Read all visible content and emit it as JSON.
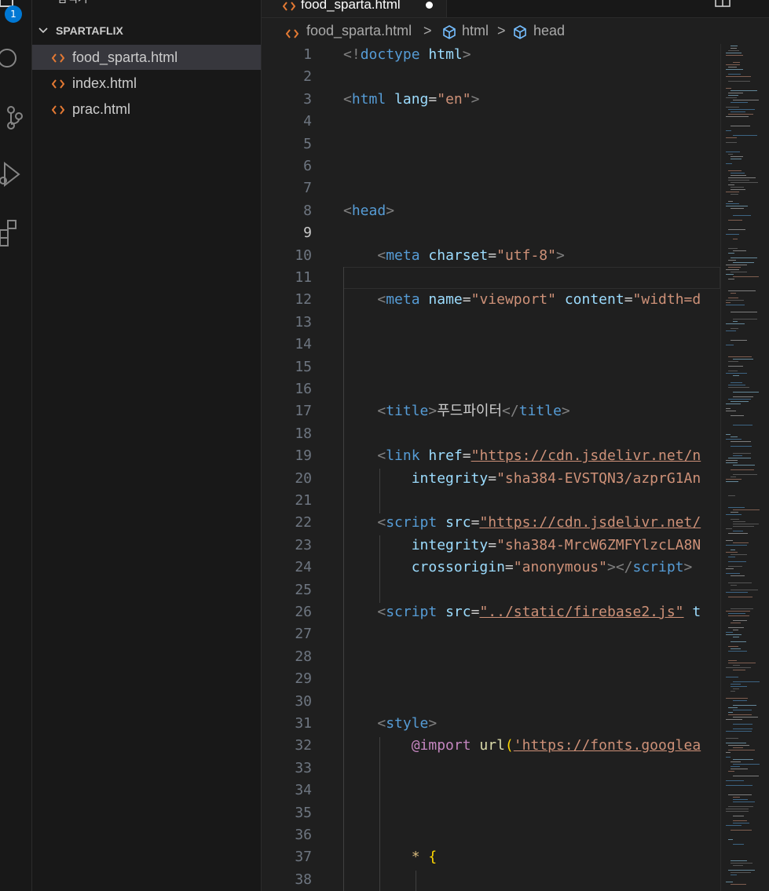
{
  "activity_bar": {
    "badge": "1"
  },
  "sidebar": {
    "title": "탐색기",
    "folder": "SPARTAFLIX",
    "files": [
      {
        "name": "food_sparta.html",
        "active": true
      },
      {
        "name": "index.html",
        "active": false
      },
      {
        "name": "prac.html",
        "active": false
      }
    ]
  },
  "editor": {
    "tab": {
      "name": "food_sparta.html"
    },
    "breadcrumb": {
      "file": "food_sparta.html",
      "sep": ">",
      "item1": "html",
      "item2": "head"
    },
    "current_line": 9,
    "lines": [
      {
        "n": "1",
        "t": [
          [
            "br",
            "<!"
          ],
          [
            "tag",
            "doctype"
          ],
          [
            "txtc",
            " "
          ],
          [
            "attr",
            "html"
          ],
          [
            "br",
            ">"
          ]
        ]
      },
      {
        "n": "2",
        "t": []
      },
      {
        "n": "3",
        "t": [
          [
            "br",
            "<"
          ],
          [
            "tag",
            "html"
          ],
          [
            "txtc",
            " "
          ],
          [
            "attr",
            "lang"
          ],
          [
            "txtc",
            "="
          ],
          [
            "str",
            "\"en\""
          ],
          [
            "br",
            ">"
          ]
        ]
      },
      {
        "n": "4",
        "t": []
      },
      {
        "n": "5",
        "t": []
      },
      {
        "n": "6",
        "t": []
      },
      {
        "n": "7",
        "t": []
      },
      {
        "n": "8",
        "t": [
          [
            "br",
            "<"
          ],
          [
            "tag",
            "head"
          ],
          [
            "br",
            ">"
          ]
        ]
      },
      {
        "n": "9",
        "t": []
      },
      {
        "n": "10",
        "t": [
          [
            "txtc",
            "    "
          ],
          [
            "br",
            "<"
          ],
          [
            "tag",
            "meta"
          ],
          [
            "txtc",
            " "
          ],
          [
            "attr",
            "charset"
          ],
          [
            "txtc",
            "="
          ],
          [
            "str",
            "\"utf-8\""
          ],
          [
            "br",
            ">"
          ]
        ]
      },
      {
        "n": "11",
        "t": []
      },
      {
        "n": "12",
        "t": [
          [
            "txtc",
            "    "
          ],
          [
            "br",
            "<"
          ],
          [
            "tag",
            "meta"
          ],
          [
            "txtc",
            " "
          ],
          [
            "attr",
            "name"
          ],
          [
            "txtc",
            "="
          ],
          [
            "str",
            "\"viewport\""
          ],
          [
            "txtc",
            " "
          ],
          [
            "attr",
            "content"
          ],
          [
            "txtc",
            "="
          ],
          [
            "str",
            "\"width=d"
          ]
        ]
      },
      {
        "n": "13",
        "t": []
      },
      {
        "n": "14",
        "t": []
      },
      {
        "n": "15",
        "t": []
      },
      {
        "n": "16",
        "t": []
      },
      {
        "n": "17",
        "t": [
          [
            "txtc",
            "    "
          ],
          [
            "br",
            "<"
          ],
          [
            "tag",
            "title"
          ],
          [
            "br",
            ">"
          ],
          [
            "txtc",
            "푸드파이터"
          ],
          [
            "br",
            "</"
          ],
          [
            "tag",
            "title"
          ],
          [
            "br",
            ">"
          ]
        ]
      },
      {
        "n": "18",
        "t": []
      },
      {
        "n": "19",
        "t": [
          [
            "txtc",
            "    "
          ],
          [
            "br",
            "<"
          ],
          [
            "tag",
            "link"
          ],
          [
            "txtc",
            " "
          ],
          [
            "attr",
            "href"
          ],
          [
            "txtc",
            "="
          ],
          [
            "str url",
            "\"https://cdn.jsdelivr.net/n"
          ]
        ]
      },
      {
        "n": "20",
        "t": [
          [
            "txtc",
            "        "
          ],
          [
            "attr",
            "integrity"
          ],
          [
            "txtc",
            "="
          ],
          [
            "str",
            "\"sha384-EVSTQN3/azprG1An"
          ]
        ]
      },
      {
        "n": "21",
        "t": []
      },
      {
        "n": "22",
        "t": [
          [
            "txtc",
            "    "
          ],
          [
            "br",
            "<"
          ],
          [
            "tag",
            "script"
          ],
          [
            "txtc",
            " "
          ],
          [
            "attr",
            "src"
          ],
          [
            "txtc",
            "="
          ],
          [
            "str url",
            "\"https://cdn.jsdelivr.net/"
          ]
        ]
      },
      {
        "n": "23",
        "t": [
          [
            "txtc",
            "        "
          ],
          [
            "attr",
            "integrity"
          ],
          [
            "txtc",
            "="
          ],
          [
            "str",
            "\"sha384-MrcW6ZMFYlzcLA8N"
          ]
        ]
      },
      {
        "n": "24",
        "t": [
          [
            "txtc",
            "        "
          ],
          [
            "attr",
            "crossorigin"
          ],
          [
            "txtc",
            "="
          ],
          [
            "str",
            "\"anonymous\""
          ],
          [
            "br",
            "></"
          ],
          [
            "tag",
            "script"
          ],
          [
            "br",
            ">"
          ]
        ]
      },
      {
        "n": "25",
        "t": []
      },
      {
        "n": "26",
        "t": [
          [
            "txtc",
            "    "
          ],
          [
            "br",
            "<"
          ],
          [
            "tag",
            "script"
          ],
          [
            "txtc",
            " "
          ],
          [
            "attr",
            "src"
          ],
          [
            "txtc",
            "="
          ],
          [
            "str url",
            "\"../static/firebase2.js\""
          ],
          [
            "txtc",
            " "
          ],
          [
            "attr",
            "t"
          ]
        ]
      },
      {
        "n": "27",
        "t": []
      },
      {
        "n": "28",
        "t": []
      },
      {
        "n": "29",
        "t": []
      },
      {
        "n": "30",
        "t": []
      },
      {
        "n": "31",
        "t": [
          [
            "txtc",
            "    "
          ],
          [
            "br",
            "<"
          ],
          [
            "tag",
            "style"
          ],
          [
            "br",
            ">"
          ]
        ]
      },
      {
        "n": "32",
        "t": [
          [
            "txtc",
            "        "
          ],
          [
            "kw",
            "@import"
          ],
          [
            "txtc",
            " "
          ],
          [
            "fn",
            "url"
          ],
          [
            "yl",
            "("
          ],
          [
            "str url",
            "'https://fonts.googlea"
          ]
        ]
      },
      {
        "n": "33",
        "t": []
      },
      {
        "n": "34",
        "t": []
      },
      {
        "n": "35",
        "t": []
      },
      {
        "n": "36",
        "t": []
      },
      {
        "n": "37",
        "t": [
          [
            "txtc",
            "        "
          ],
          [
            "sel",
            "*"
          ],
          [
            "txtc",
            " "
          ],
          [
            "yl",
            "{"
          ]
        ]
      },
      {
        "n": "38",
        "t": []
      }
    ]
  }
}
